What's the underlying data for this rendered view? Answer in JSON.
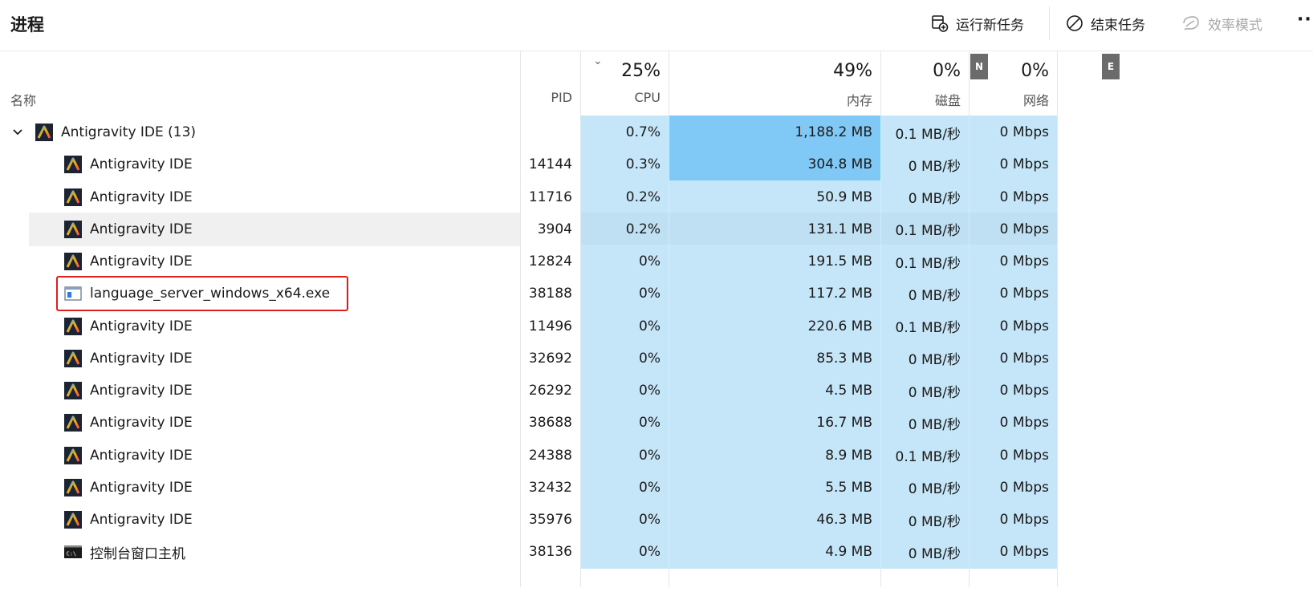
{
  "page": {
    "title": "进程"
  },
  "toolbar": {
    "run_new_task": "运行新任务",
    "end_task": "结束任务",
    "efficiency_mode": "效率模式",
    "more": "···"
  },
  "columns": {
    "name": "名称",
    "pid": "PID",
    "cpu": {
      "pct": "25%",
      "label": "CPU"
    },
    "memory": {
      "pct": "49%",
      "label": "内存"
    },
    "disk": {
      "pct": "0%",
      "label": "磁盘"
    },
    "network": {
      "pct": "0%",
      "label": "网络"
    },
    "tag_n": "N",
    "tag_e": "E"
  },
  "colors": {
    "cpu_bg": "#c5e6f9",
    "mem_bg": "#c5e6f9",
    "mem_heavy": "#80c8f5",
    "disk_bg": "#c5e6f9",
    "net_bg": "#c5e6f9",
    "highlight": "#e0201f"
  },
  "group": {
    "name": "Antigravity IDE (13)",
    "cpu": "0.7%",
    "memory": "1,188.2 MB",
    "disk": "0.1 MB/秒",
    "network": "0 Mbps",
    "expanded": true
  },
  "processes": [
    {
      "name": "Antigravity IDE",
      "icon": "antigravity-icon",
      "pid": "14144",
      "cpu": "0.3%",
      "memory": "304.8 MB",
      "disk": "0 MB/秒",
      "network": "0 Mbps",
      "mem_heavy": true
    },
    {
      "name": "Antigravity IDE",
      "icon": "antigravity-icon",
      "pid": "11716",
      "cpu": "0.2%",
      "memory": "50.9 MB",
      "disk": "0 MB/秒",
      "network": "0 Mbps"
    },
    {
      "name": "Antigravity IDE",
      "icon": "antigravity-icon",
      "pid": "3904",
      "cpu": "0.2%",
      "memory": "131.1 MB",
      "disk": "0.1 MB/秒",
      "network": "0 Mbps",
      "hover": true
    },
    {
      "name": "Antigravity IDE",
      "icon": "antigravity-icon",
      "pid": "12824",
      "cpu": "0%",
      "memory": "191.5 MB",
      "disk": "0.1 MB/秒",
      "network": "0 Mbps"
    },
    {
      "name": "language_server_windows_x64.exe",
      "icon": "exe-window-icon",
      "pid": "38188",
      "cpu": "0%",
      "memory": "117.2 MB",
      "disk": "0 MB/秒",
      "network": "0 Mbps",
      "highlighted": true
    },
    {
      "name": "Antigravity IDE",
      "icon": "antigravity-icon",
      "pid": "11496",
      "cpu": "0%",
      "memory": "220.6 MB",
      "disk": "0.1 MB/秒",
      "network": "0 Mbps"
    },
    {
      "name": "Antigravity IDE",
      "icon": "antigravity-icon",
      "pid": "32692",
      "cpu": "0%",
      "memory": "85.3 MB",
      "disk": "0 MB/秒",
      "network": "0 Mbps"
    },
    {
      "name": "Antigravity IDE",
      "icon": "antigravity-icon",
      "pid": "26292",
      "cpu": "0%",
      "memory": "4.5 MB",
      "disk": "0 MB/秒",
      "network": "0 Mbps"
    },
    {
      "name": "Antigravity IDE",
      "icon": "antigravity-icon",
      "pid": "38688",
      "cpu": "0%",
      "memory": "16.7 MB",
      "disk": "0 MB/秒",
      "network": "0 Mbps"
    },
    {
      "name": "Antigravity IDE",
      "icon": "antigravity-icon",
      "pid": "24388",
      "cpu": "0%",
      "memory": "8.9 MB",
      "disk": "0.1 MB/秒",
      "network": "0 Mbps"
    },
    {
      "name": "Antigravity IDE",
      "icon": "antigravity-icon",
      "pid": "32432",
      "cpu": "0%",
      "memory": "5.5 MB",
      "disk": "0 MB/秒",
      "network": "0 Mbps"
    },
    {
      "name": "Antigravity IDE",
      "icon": "antigravity-icon",
      "pid": "35976",
      "cpu": "0%",
      "memory": "46.3 MB",
      "disk": "0 MB/秒",
      "network": "0 Mbps"
    },
    {
      "name": "控制台窗口主机",
      "icon": "console-icon",
      "pid": "38136",
      "cpu": "0%",
      "memory": "4.9 MB",
      "disk": "0 MB/秒",
      "network": "0 Mbps"
    }
  ]
}
